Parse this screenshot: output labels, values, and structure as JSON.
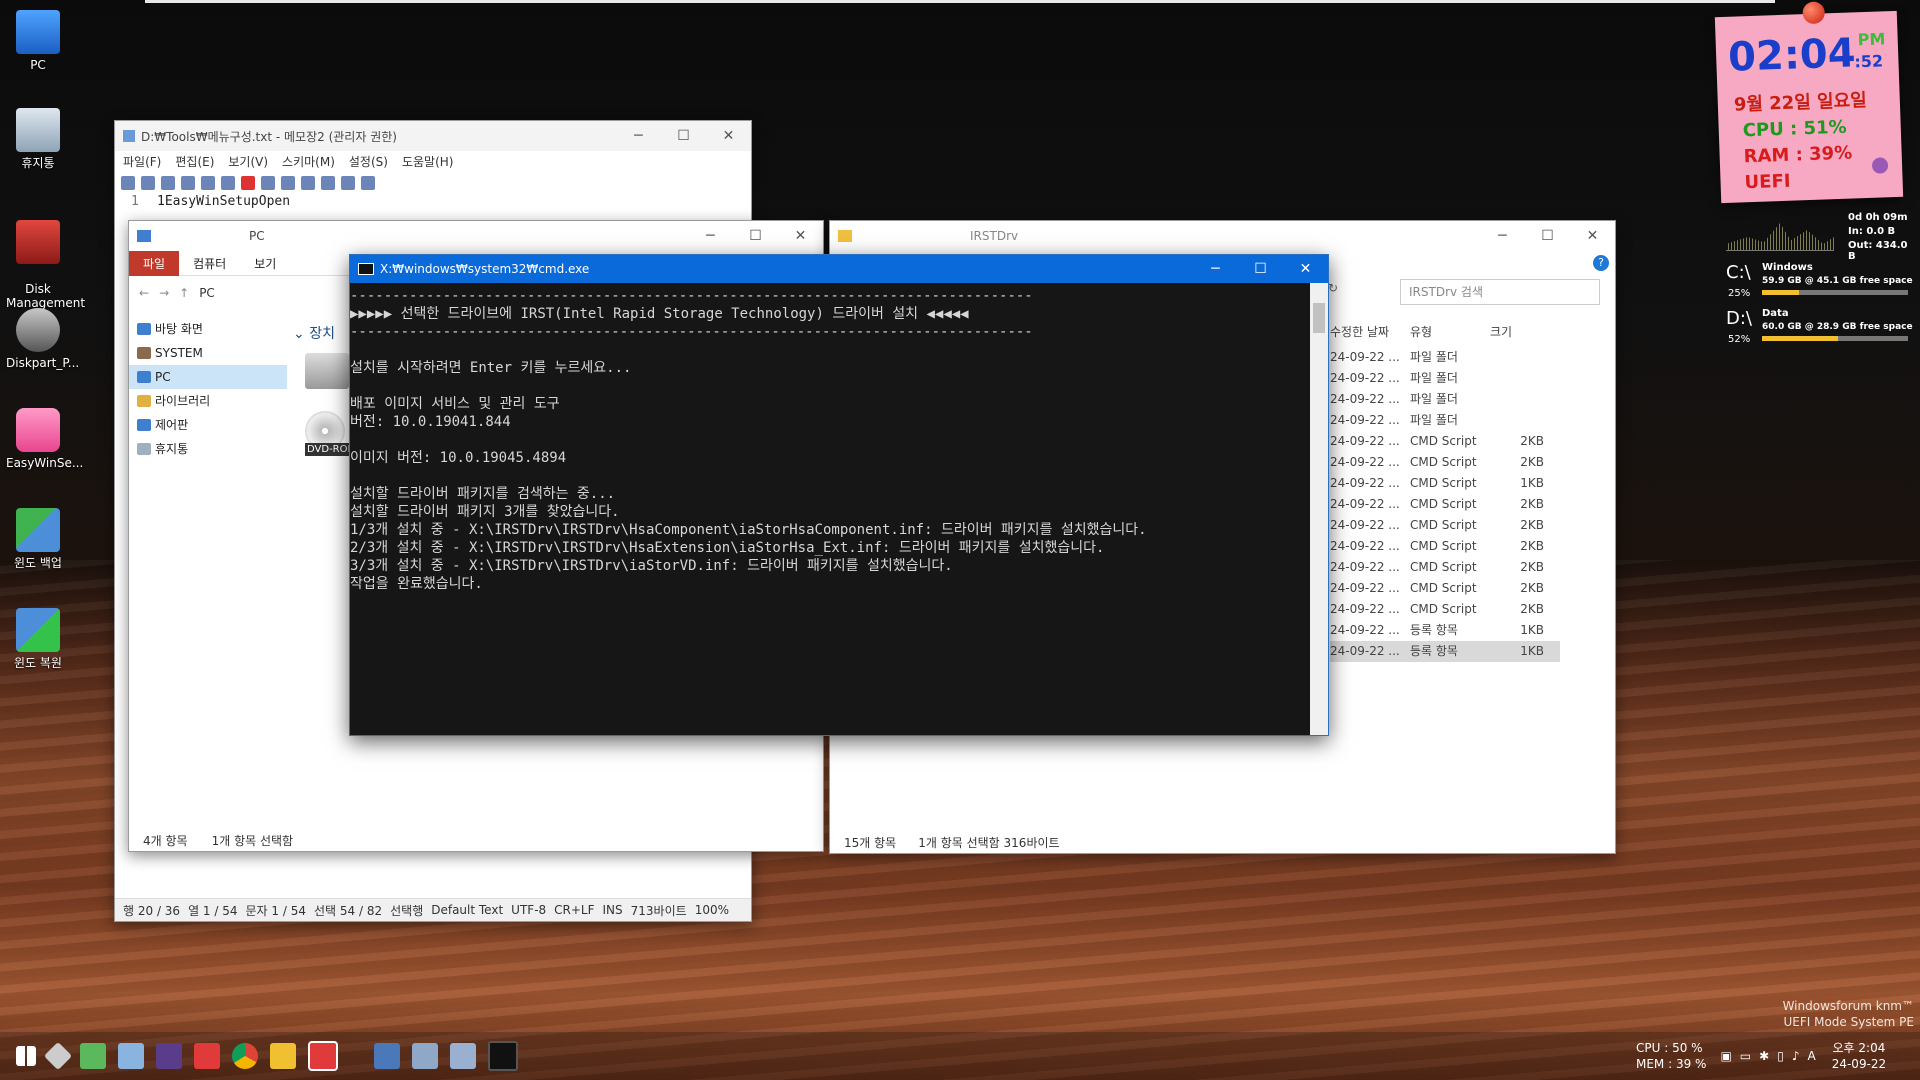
{
  "desktop": {
    "icons": [
      "PC",
      "휴지통",
      "Disk\nManagement",
      "Diskpart_P...",
      "EasyWinSe...",
      "윈도 백업",
      "윈도 복원"
    ],
    "brand_line1": "Windowsforum knm™",
    "brand_line2": "UEFI Mode System PE"
  },
  "clock_widget": {
    "time": "02:04",
    "seconds": ":52",
    "ampm": "PM",
    "date": "9월 22일 일요일",
    "cpu": "CPU : 51%",
    "ram": "RAM : 39%",
    "mode": "UEFI"
  },
  "meter": {
    "uptime": "0d 0h 09m",
    "in": "In: 0.0 B",
    "out": "Out: 434.0 B",
    "c_drive": "C:\\",
    "c_pct": "25%",
    "c_name": "Windows",
    "c_info": "59.9 GB @    45.1 GB free space",
    "d_drive": "D:\\",
    "d_pct": "52%",
    "d_name": "Data",
    "d_info": "60.0 GB @    28.9 GB free space"
  },
  "notepad": {
    "title": "D:₩Tools₩메뉴구성.txt - 메모장2 (관리자 권한)",
    "menu": [
      "파일(F)",
      "편집(E)",
      "보기(V)",
      "스키마(M)",
      "설정(S)",
      "도움말(H)"
    ],
    "line_no": "1",
    "line1": "1EasyWinSetupOpen",
    "status": [
      "행 20 / 36",
      "열 1 / 54",
      "문자 1 / 54",
      "선택 54 / 82",
      "선택행",
      "Default Text",
      "UTF-8",
      "CR+LF",
      "INS",
      "713바이트",
      "100%"
    ]
  },
  "explorer_pc": {
    "title": "PC",
    "ribbon": [
      "파일",
      "컴퓨터",
      "보기"
    ],
    "address": "PC",
    "tree": [
      "바탕 화면",
      "SYSTEM",
      "PC",
      "라이브러리",
      "제어판",
      "휴지통"
    ],
    "group": "장치",
    "dvd_label": "DVD-ROM",
    "status_items": "4개 항목",
    "status_sel": "1개 항목 선택함"
  },
  "explorer_irst": {
    "title": "IRSTDrv",
    "search_placeholder": "IRSTDrv 검색",
    "columns": [
      "수정한 날짜",
      "유형",
      "크기"
    ],
    "rows": [
      [
        "24-09-22 ...",
        "파일 폴더",
        ""
      ],
      [
        "24-09-22 ...",
        "파일 폴더",
        ""
      ],
      [
        "24-09-22 ...",
        "파일 폴더",
        ""
      ],
      [
        "24-09-22 ...",
        "파일 폴더",
        ""
      ],
      [
        "24-09-22 ...",
        "CMD Script",
        "2KB"
      ],
      [
        "24-09-22 ...",
        "CMD Script",
        "2KB"
      ],
      [
        "24-09-22 ...",
        "CMD Script",
        "1KB"
      ],
      [
        "24-09-22 ...",
        "CMD Script",
        "2KB"
      ],
      [
        "24-09-22 ...",
        "CMD Script",
        "2KB"
      ],
      [
        "24-09-22 ...",
        "CMD Script",
        "2KB"
      ],
      [
        "24-09-22 ...",
        "CMD Script",
        "2KB"
      ],
      [
        "24-09-22 ...",
        "CMD Script",
        "2KB"
      ],
      [
        "24-09-22 ...",
        "CMD Script",
        "2KB"
      ],
      [
        "24-09-22 ...",
        "등록 항목",
        "1KB"
      ],
      [
        "24-09-22 ...",
        "등록 항목",
        "1KB"
      ]
    ],
    "status_items": "15개 항목",
    "status_sel": "1개 항목 선택함 316바이트"
  },
  "cmd": {
    "title": "X:₩windows₩system32₩cmd.exe",
    "lines": [
      "---------------------------------------------------------------------------------",
      "▶▶▶▶▶ 선택한 드라이브에 IRST(Intel Rapid Storage Technology) 드라이버 설치 ◀◀◀◀◀",
      "---------------------------------------------------------------------------------",
      "",
      "설치를 시작하려면 Enter 키를 누르세요...",
      "",
      "배포 이미지 서비스 및 관리 도구",
      "버전: 10.0.19041.844",
      "",
      "이미지 버전: 10.0.19045.4894",
      "",
      "설치할 드라이버 패키지를 검색하는 중...",
      "설치할 드라이버 패키지 3개를 찾았습니다.",
      "1/3개 설치 중 - X:\\IRSTDrv\\IRSTDrv\\HsaComponent\\iaStorHsaComponent.inf: 드라이버 패키지를 설치했습니다.",
      "2/3개 설치 중 - X:\\IRSTDrv\\IRSTDrv\\HsaExtension\\iaStorHsa_Ext.inf: 드라이버 패키지를 설치했습니다.",
      "3/3개 설치 중 - X:\\IRSTDrv\\IRSTDrv\\iaStorVD.inf: 드라이버 패키지를 설치했습니다.",
      "작업을 완료했습니다."
    ]
  },
  "tray": {
    "cpu": "CPU : 50 %",
    "mem": "MEM : 39 %",
    "ime": "A",
    "time": "오후 2:04",
    "date": "24-09-22"
  }
}
